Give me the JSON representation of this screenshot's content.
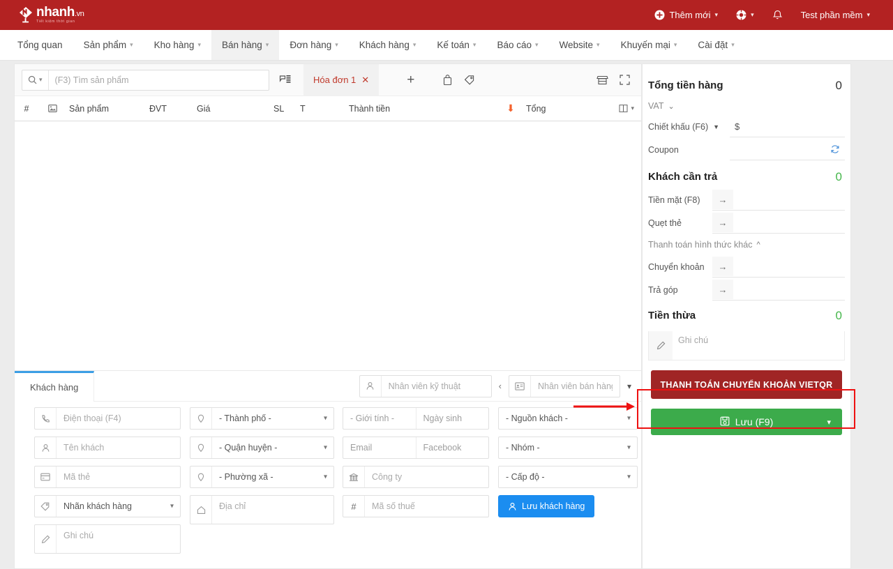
{
  "brand": {
    "name": "nhanh",
    "tld": ".vn",
    "tagline": "Tiết kiệm thời gian",
    "header_color": "#b32222"
  },
  "topbar": {
    "add_new": "Thêm mới",
    "user": "Test phần mềm",
    "icons": [
      "plus-circle-icon",
      "lifebuoy-icon",
      "bell-icon"
    ]
  },
  "nav": {
    "items": [
      {
        "label": "Tổng quan",
        "caret": false,
        "active": false
      },
      {
        "label": "Sản phẩm",
        "caret": true,
        "active": false
      },
      {
        "label": "Kho hàng",
        "caret": true,
        "active": false
      },
      {
        "label": "Bán hàng",
        "caret": true,
        "active": true
      },
      {
        "label": "Đơn hàng",
        "caret": true,
        "active": false
      },
      {
        "label": "Khách hàng",
        "caret": true,
        "active": false
      },
      {
        "label": "Kế toán",
        "caret": true,
        "active": false
      },
      {
        "label": "Báo cáo",
        "caret": true,
        "active": false
      },
      {
        "label": "Website",
        "caret": true,
        "active": false
      },
      {
        "label": "Khuyến mại",
        "caret": true,
        "active": false
      },
      {
        "label": "Cài đặt",
        "caret": true,
        "active": false
      }
    ]
  },
  "order": {
    "search_placeholder": "(F3) Tìm sản phẩm",
    "search_value": "",
    "tab_label": "Hóa đơn 1",
    "add_tab": "+",
    "columns": [
      "#",
      "image-icon",
      "Sản phẩm",
      "ĐVT",
      "Giá",
      "SL",
      "T",
      "Thành tiền",
      "sort-down-icon",
      "Tổng",
      "columns-icon"
    ],
    "rows": []
  },
  "customer": {
    "tab_label": "Khách hàng",
    "technician_placeholder": "Nhân viên kỹ thuật",
    "technician_value": "",
    "seller_placeholder": "Nhân viên bán hàng",
    "seller_value": "",
    "fields": {
      "phone": "Điện thoại (F4)",
      "name": "Tên khách",
      "card": "Mã thẻ",
      "tag": "Nhãn khách hàng",
      "note": "Ghi chú",
      "city": "- Thành phố -",
      "district": "- Quận huyện -",
      "ward": "- Phường xã -",
      "address": "Địa chỉ",
      "gender": "- Giới tính -",
      "birthday": "Ngày sinh",
      "email": "Email",
      "facebook": "Facebook",
      "company": "Công ty",
      "tax_code": "Mã số thuế",
      "source": "- Nguồn khách -",
      "group": "- Nhóm -",
      "level": "- Cấp độ -"
    },
    "save_button": "Lưu khách hàng"
  },
  "summary": {
    "total_label": "Tổng tiền hàng",
    "total_value": "0",
    "vat_label": "VAT",
    "discount_label": "Chiết khấu (F6)",
    "discount_prefix": "$",
    "discount_value": "",
    "coupon_label": "Coupon",
    "coupon_value": "",
    "payable_label": "Khách cần trả",
    "payable_value": "0",
    "cash_label": "Tiền mặt (F8)",
    "cash_value": "",
    "card_label": "Quẹt thẻ",
    "card_value": "",
    "other_methods_label": "Thanh toán hình thức khác",
    "transfer_label": "Chuyển khoản",
    "transfer_value": "",
    "installment_label": "Trả góp",
    "installment_value": "",
    "change_label": "Tiền thừa",
    "change_value": "0",
    "note_placeholder": "Ghi chú",
    "note_value": "",
    "vietqr_button": "THANH TOÁN CHUYỂN KHOẢN VIETQR",
    "save_button": "Lưu (F9)",
    "green_color": "#45b64b",
    "vietqr_color": "#a02525",
    "save_color": "#3cab4b"
  },
  "annotation": {
    "highlight_color": "#ee1111",
    "arrow_target": "vietqr-button"
  }
}
